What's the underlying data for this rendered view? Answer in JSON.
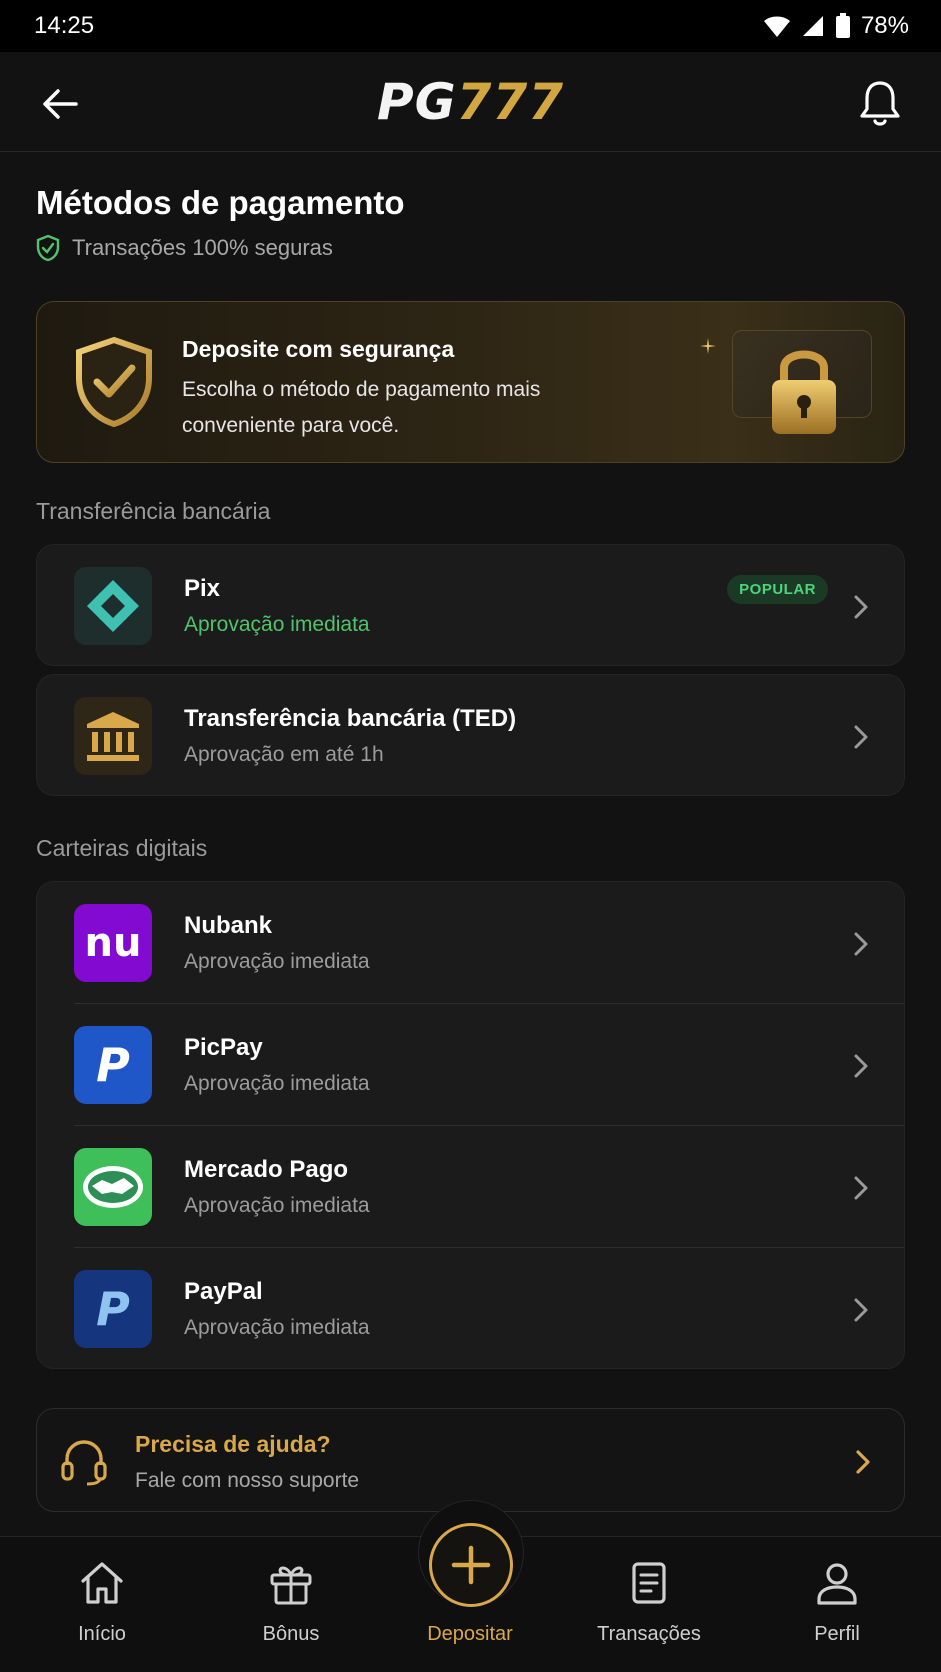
{
  "status_bar": {
    "time": "14:25",
    "battery": "78%"
  },
  "header": {
    "logo_left": "PG",
    "logo_right": "777"
  },
  "page": {
    "title": "Métodos de pagamento",
    "secure_text": "Transações 100% seguras"
  },
  "banner": {
    "title": "Deposite com segurança",
    "text": "Escolha o método de pagamento mais conveniente para você."
  },
  "bank_section": {
    "label": "Transferência bancária",
    "items": [
      {
        "name": "Pix",
        "sub": "Aprovação imediata",
        "badge": "POPULAR"
      },
      {
        "name": "Transferência bancária (TED)",
        "sub": "Aprovação em até 1h"
      }
    ]
  },
  "wallet_section": {
    "label": "Carteiras digitais",
    "items": [
      {
        "name": "Nubank",
        "sub": "Aprovação imediata",
        "logo_text": "nu"
      },
      {
        "name": "PicPay",
        "sub": "Aprovação imediata",
        "logo_text": "P"
      },
      {
        "name": "Mercado Pago",
        "sub": "Aprovação imediata"
      },
      {
        "name": "PayPal",
        "sub": "Aprovação imediata",
        "logo_text": "P"
      }
    ]
  },
  "help": {
    "title": "Precisa de ajuda?",
    "sub": "Fale com nosso suporte"
  },
  "bottom_nav": {
    "items": [
      {
        "label": "Início",
        "icon": "home-icon"
      },
      {
        "label": "Bônus",
        "icon": "gift-icon"
      },
      {
        "label": "Depositar",
        "icon": "plus-icon",
        "active": true
      },
      {
        "label": "Transações",
        "icon": "document-icon"
      },
      {
        "label": "Perfil",
        "icon": "user-icon"
      }
    ]
  },
  "colors": {
    "accent_gold": "#d8a84a",
    "success_green": "#4fc46a",
    "background": "#121212"
  }
}
